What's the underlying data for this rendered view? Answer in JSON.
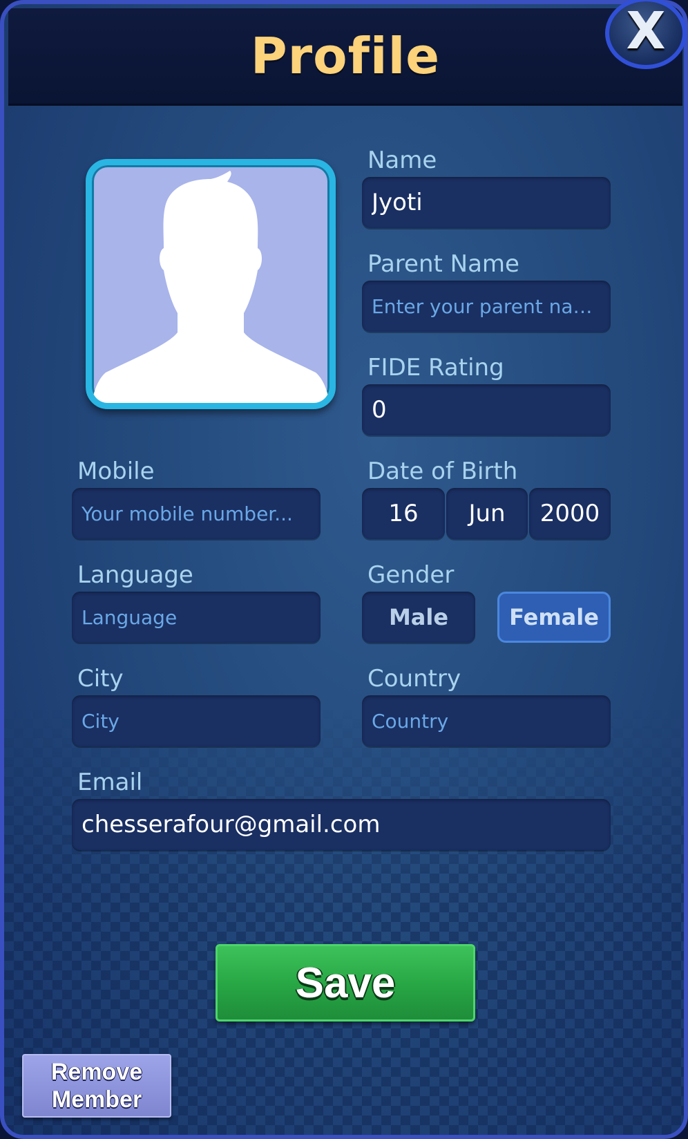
{
  "header": {
    "title": "Profile",
    "close_icon": "close-icon",
    "close_glyph": "X"
  },
  "avatar": {
    "icon": "default-avatar-silhouette-icon",
    "background_color": "#a8b4ea",
    "frame_color": "#29b6e3"
  },
  "form": {
    "name": {
      "label": "Name",
      "value": "Jyoti"
    },
    "parent_name": {
      "label": "Parent Name",
      "placeholder": "Enter your parent name..."
    },
    "fide_rating": {
      "label": "FIDE Rating",
      "value": "0"
    },
    "mobile": {
      "label": "Mobile",
      "placeholder": "Your mobile number..."
    },
    "date_of_birth": {
      "label": "Date of Birth",
      "day": "16",
      "month": "Jun",
      "year": "2000"
    },
    "language": {
      "label": "Language",
      "placeholder": "Language"
    },
    "gender": {
      "label": "Gender",
      "options": [
        "Male",
        "Female"
      ],
      "selected": "Female"
    },
    "city": {
      "label": "City",
      "placeholder": "City"
    },
    "country": {
      "label": "Country",
      "placeholder": "Country"
    },
    "email": {
      "label": "Email",
      "value": "chesserafour@gmail.com"
    }
  },
  "actions": {
    "save_label": "Save",
    "remove_member_label": "Remove\nMember"
  },
  "colors": {
    "title": "#fcd27a",
    "save_button": "#27a544",
    "selected_gender": "#2e5fb4",
    "field_bg": "#1a2f62",
    "label": "#a9d3ee"
  }
}
